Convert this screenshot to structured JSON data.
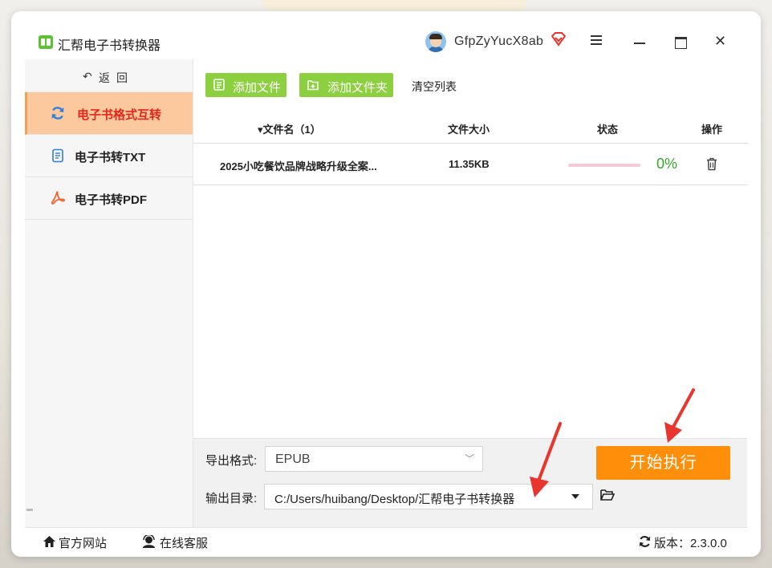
{
  "app": {
    "title": "汇帮电子书转换器",
    "username": "GfpZyYucX8ab"
  },
  "sidebar": {
    "back_arrow": "↶",
    "back_label": "返回",
    "items": [
      {
        "label": "电子书格式互转",
        "icon": "refresh-icon",
        "active": true
      },
      {
        "label": "电子书转TXT",
        "icon": "document-icon",
        "active": false
      },
      {
        "label": "电子书转PDF",
        "icon": "pdf-icon",
        "active": false
      }
    ]
  },
  "toolbar": {
    "add_file": "添加文件",
    "add_folder": "添加文件夹",
    "clear_list": "清空列表"
  },
  "table": {
    "headers": {
      "name": "▾文件名（1）",
      "size": "文件大小",
      "status": "状态",
      "action": "操作"
    },
    "rows": [
      {
        "name": "2025小吃餐饮品牌战略升级全案...",
        "size": "11.35KB",
        "progress": 0,
        "percent": "0%"
      }
    ]
  },
  "bottom": {
    "format_label": "导出格式:",
    "format_value": "EPUB",
    "format_chevron": "﹀",
    "dir_label": "输出目录:",
    "dir_value": "C:/Users/huibang/Desktop/汇帮电子书转换器",
    "start_button": "开始执行"
  },
  "footer": {
    "website": "官方网站",
    "support": "在线客服",
    "version": "版本：2.3.0.0"
  },
  "colors": {
    "accent_green": "#8ccf3f",
    "start_orange": "#ff8e0a",
    "active_nav_bg": "#fbc99d",
    "active_nav_text": "#e5261b",
    "percent_green": "#35a62a",
    "arrow_red": "#e8362f"
  }
}
